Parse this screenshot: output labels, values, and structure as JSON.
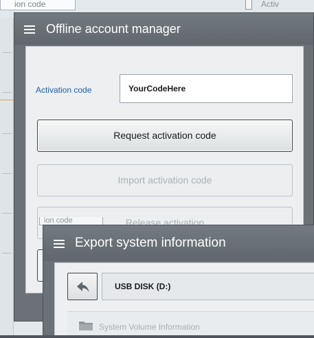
{
  "background": {
    "top_field_text": "ion code",
    "top_right_text": "Activ"
  },
  "offline_dialog": {
    "title": "Offline account manager",
    "activation_label": "Activation code",
    "activation_value": "YourCodeHere",
    "request_button": "Request  activation code",
    "import_button": "Import activation code",
    "release_button": "Release activation"
  },
  "export_dialog": {
    "behind_field_text": "ion code",
    "title": "Export system information",
    "path": "USB DISK (D:)",
    "items": [
      {
        "name": "System Volume Information",
        "icon": "folder-icon"
      }
    ]
  },
  "colors": {
    "title_bar": "#6b7176",
    "label_blue": "#1f5fa8",
    "accent_orange": "#e6a04a"
  }
}
